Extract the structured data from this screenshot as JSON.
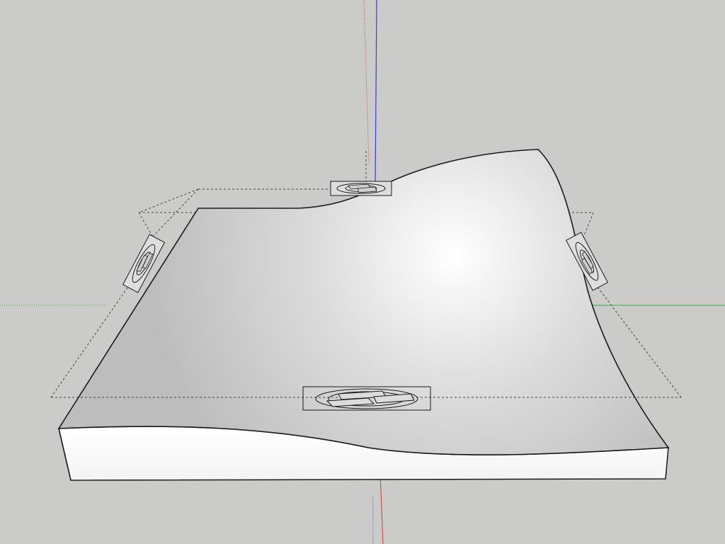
{
  "app": {
    "scene": "3d-modeling-viewport"
  },
  "colors": {
    "background": "#cbcbca",
    "axis_red": "#d23a3a",
    "axis_green": "#3fae3f",
    "axis_blue": "#3a3ad8",
    "edge": "#1a1a1a",
    "bounding_box": "#444444",
    "side_face": "#ffffff",
    "top_face_light": "#ffffff",
    "top_face_dark": "#b9b9b9"
  },
  "icons": {
    "gizmo_front": "rotate-gizmo-icon",
    "gizmo_back": "rotate-gizmo-icon",
    "gizmo_left": "rotate-gizmo-icon",
    "gizmo_right": "rotate-gizmo-icon"
  }
}
